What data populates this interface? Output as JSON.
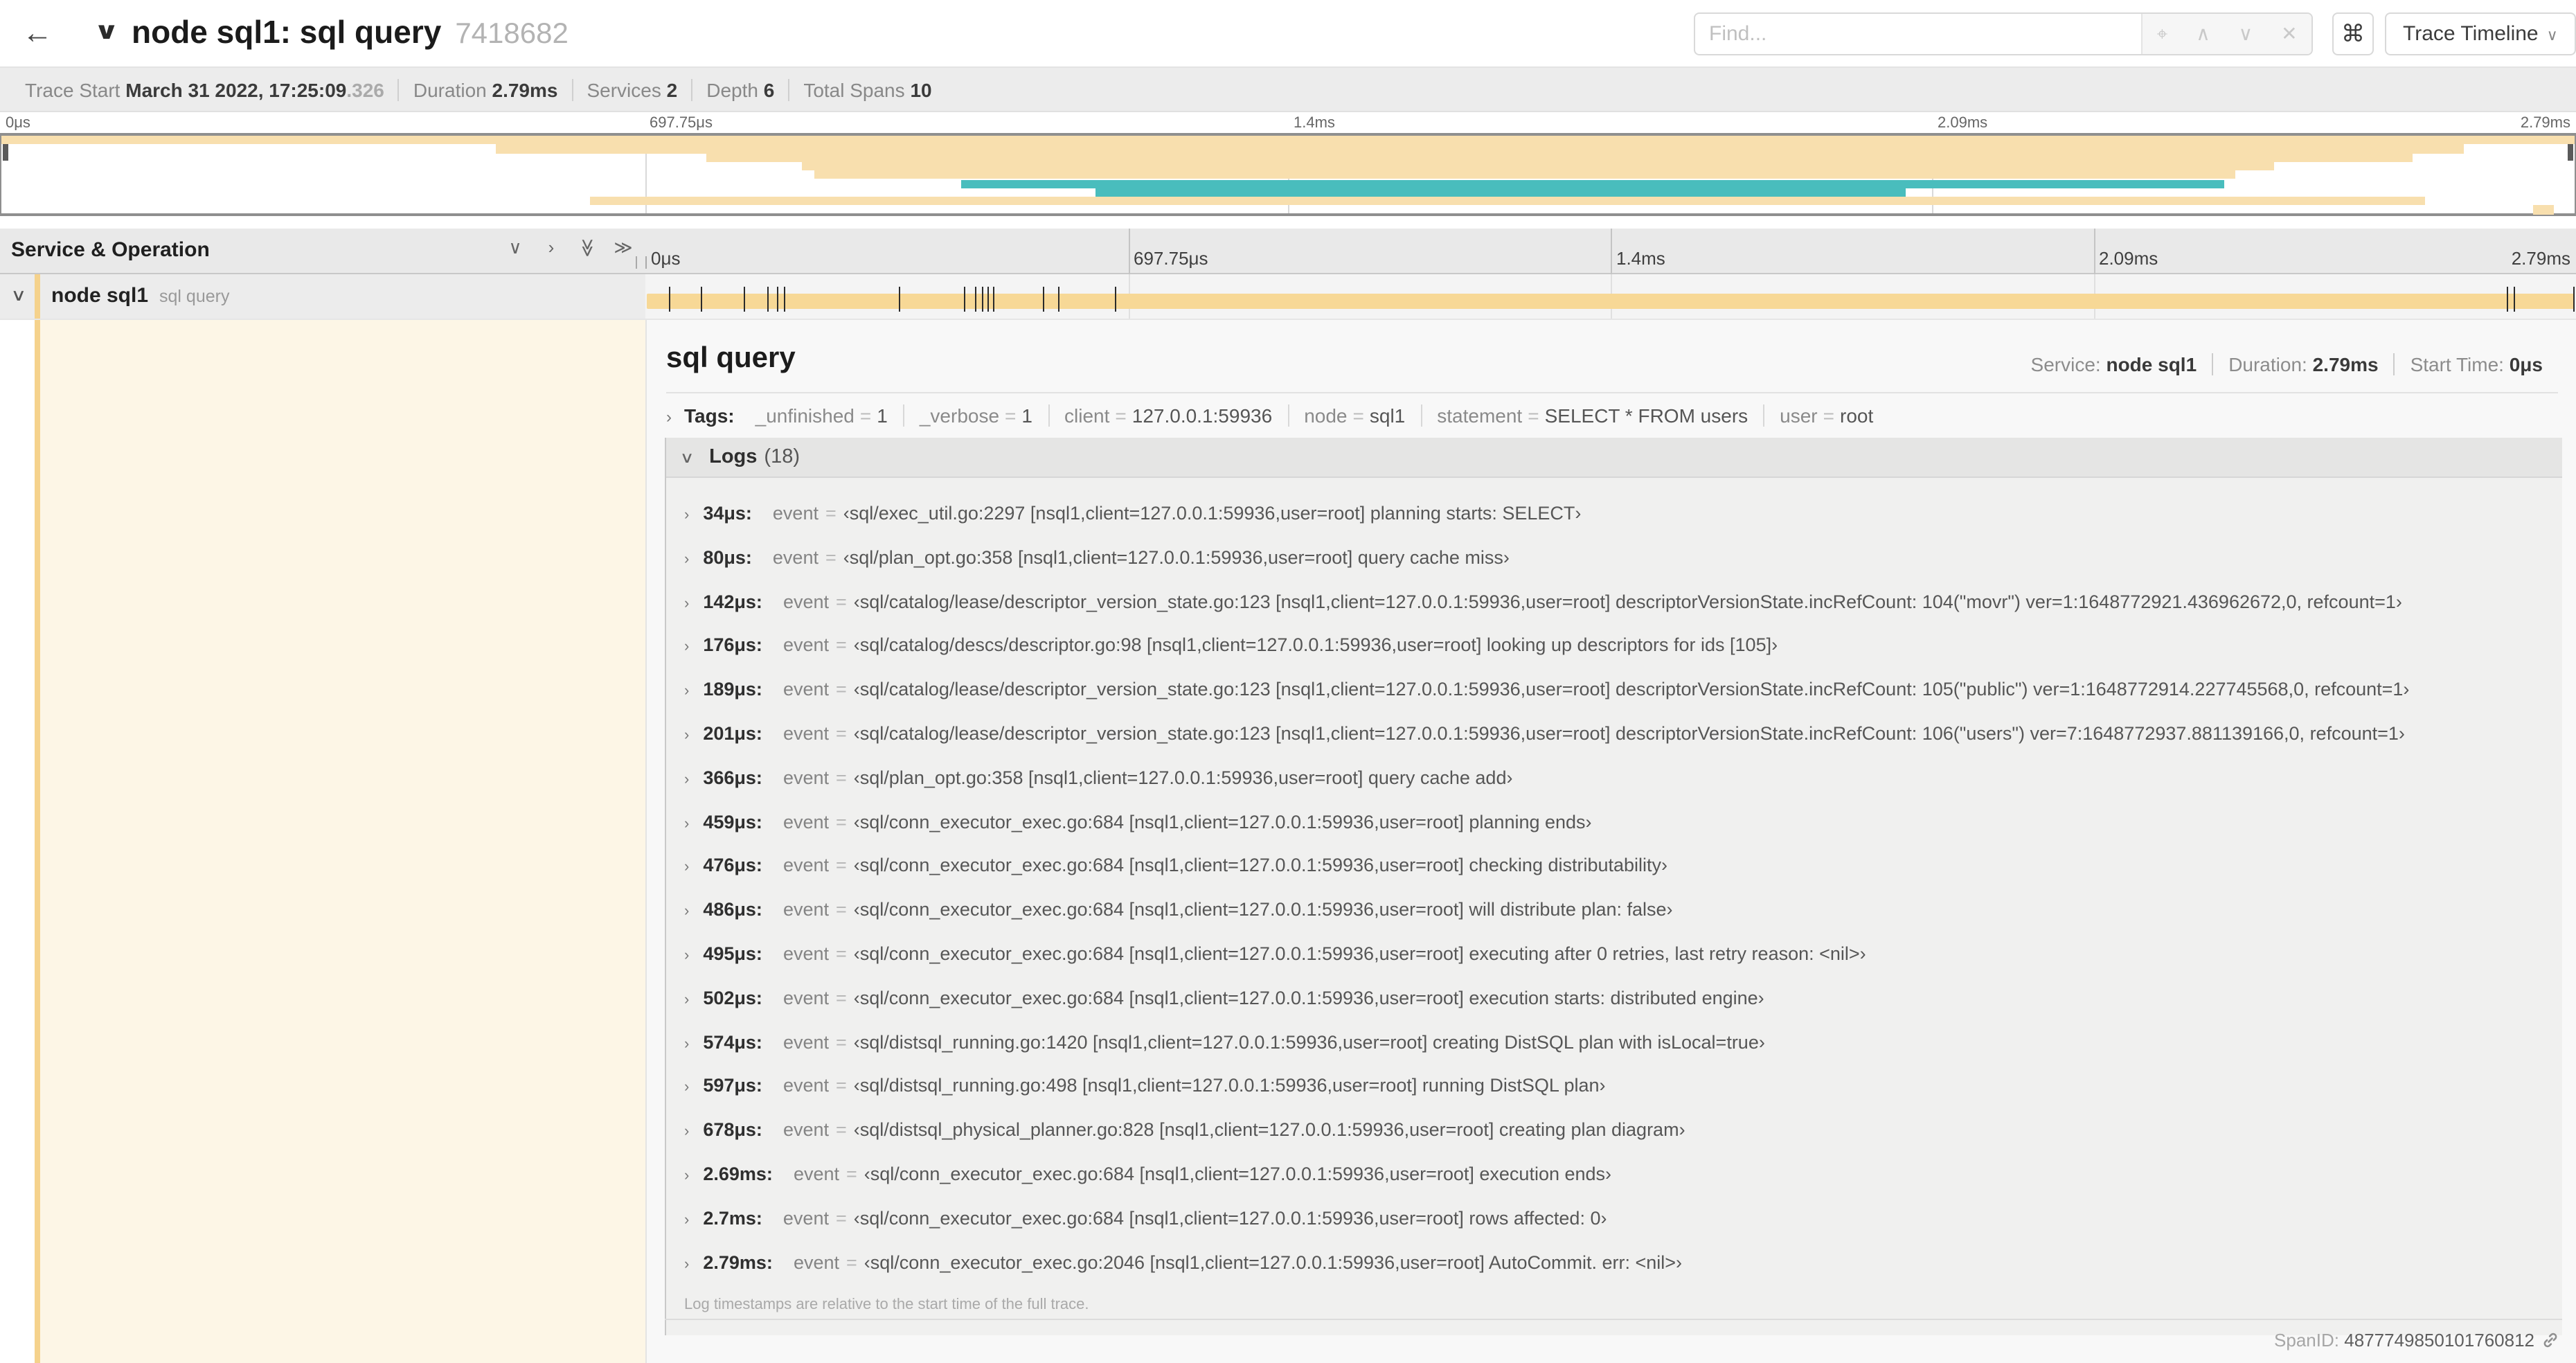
{
  "header": {
    "back_icon": "←",
    "collapse_icon": "∨",
    "title": "node sql1: sql query",
    "trace_id": "7418682",
    "find_placeholder": "Find...",
    "find_icons": [
      {
        "name": "locate-icon",
        "glyph": "⌖"
      },
      {
        "name": "prev-match-icon",
        "glyph": "∧"
      },
      {
        "name": "next-match-icon",
        "glyph": "∨"
      },
      {
        "name": "clear-icon",
        "glyph": "✕"
      }
    ],
    "shortcut_icon": "⌘",
    "view_selector": {
      "label": "Trace Timeline",
      "chevron": "∨"
    }
  },
  "summary": {
    "items": [
      {
        "label": "Trace Start",
        "value": "March 31 2022, 17:25:09",
        "suffix": ".326"
      },
      {
        "label": "Duration",
        "value": "2.79ms"
      },
      {
        "label": "Services",
        "value": "2"
      },
      {
        "label": "Depth",
        "value": "6"
      },
      {
        "label": "Total Spans",
        "value": "10"
      }
    ]
  },
  "colors": {
    "tan": "#f8dfae",
    "teal": "#49bdbd",
    "bar_tan": "#f7d896",
    "stripe_tan": "#f5d28c"
  },
  "minimap": {
    "ticks": [
      "0μs",
      "697.75μs",
      "1.4ms",
      "2.09ms",
      "2.79ms"
    ],
    "spans": [
      {
        "left": 0,
        "width": 100,
        "color": "#f8dfae"
      },
      {
        "left": 19.2,
        "width": 76.5,
        "color": "#f8dfae"
      },
      {
        "left": 27.4,
        "width": 66.3,
        "color": "#f8dfae"
      },
      {
        "left": 31.1,
        "width": 57.2,
        "color": "#f8dfae"
      },
      {
        "left": 31.6,
        "width": 55.2,
        "color": "#f8dfae"
      },
      {
        "left": 37.3,
        "width": 49.1,
        "color": "#49bdbd"
      },
      {
        "left": 42.5,
        "width": 31.5,
        "color": "#49bdbd"
      },
      {
        "left": 22.9,
        "width": 71.3,
        "color": "#f8dfae"
      },
      {
        "left": 98.4,
        "width": 0.8,
        "color": "#f8dfae"
      }
    ]
  },
  "timeline_header": {
    "left_title": "Service & Operation",
    "icons": [
      {
        "name": "collapse-one-icon",
        "glyph": "∨",
        "rotate": false
      },
      {
        "name": "expand-one-icon",
        "glyph": "›",
        "rotate": false
      },
      {
        "name": "collapse-all-icon",
        "glyph": "≫",
        "rotate": true
      },
      {
        "name": "expand-all-icon",
        "glyph": "≫",
        "rotate": false
      }
    ],
    "ticks": [
      "0μs",
      "697.75μs",
      "1.4ms",
      "2.09ms",
      "2.79ms"
    ]
  },
  "span_row": {
    "chevron": "∨",
    "service": "node sql1",
    "operation": "sql query",
    "bar": {
      "left": 0.05,
      "width": 99.9
    },
    "marker_pcts": [
      1.2,
      2.9,
      5.1,
      6.3,
      6.8,
      7.2,
      13.1,
      16.5,
      17.1,
      17.4,
      17.7,
      18.0,
      20.6,
      21.4,
      24.3,
      96.4,
      96.8,
      99.85
    ]
  },
  "detail": {
    "title": "sql query",
    "meta": [
      {
        "label": "Service:",
        "value": "node sql1"
      },
      {
        "label": "Duration:",
        "value": "2.79ms"
      },
      {
        "label": "Start Time:",
        "value": "0μs"
      }
    ],
    "tags": {
      "chevron": "›",
      "label": "Tags:",
      "items": [
        {
          "key": "_unfinished",
          "value": "1"
        },
        {
          "key": "_verbose",
          "value": "1"
        },
        {
          "key": "client",
          "value": "127.0.0.1:59936"
        },
        {
          "key": "node",
          "value": "sql1"
        },
        {
          "key": "statement",
          "value": "SELECT * FROM users"
        },
        {
          "key": "user",
          "value": "root"
        }
      ]
    },
    "logs": {
      "chevron": "∨",
      "label": "Logs",
      "count": "(18)",
      "rows": [
        {
          "t": "34μs:",
          "key": "event",
          "value": "‹sql/exec_util.go:2297 [nsql1,client=127.0.0.1:59936,user=root] planning starts: SELECT›"
        },
        {
          "t": "80μs:",
          "key": "event",
          "value": "‹sql/plan_opt.go:358 [nsql1,client=127.0.0.1:59936,user=root] query cache miss›"
        },
        {
          "t": "142μs:",
          "key": "event",
          "value": "‹sql/catalog/lease/descriptor_version_state.go:123 [nsql1,client=127.0.0.1:59936,user=root] descriptorVersionState.incRefCount: 104(\"movr\") ver=1:1648772921.436962672,0, refcount=1›"
        },
        {
          "t": "176μs:",
          "key": "event",
          "value": "‹sql/catalog/descs/descriptor.go:98 [nsql1,client=127.0.0.1:59936,user=root] looking up descriptors for ids [105]›"
        },
        {
          "t": "189μs:",
          "key": "event",
          "value": "‹sql/catalog/lease/descriptor_version_state.go:123 [nsql1,client=127.0.0.1:59936,user=root] descriptorVersionState.incRefCount: 105(\"public\") ver=1:1648772914.227745568,0, refcount=1›"
        },
        {
          "t": "201μs:",
          "key": "event",
          "value": "‹sql/catalog/lease/descriptor_version_state.go:123 [nsql1,client=127.0.0.1:59936,user=root] descriptorVersionState.incRefCount: 106(\"users\") ver=7:1648772937.881139166,0, refcount=1›"
        },
        {
          "t": "366μs:",
          "key": "event",
          "value": "‹sql/plan_opt.go:358 [nsql1,client=127.0.0.1:59936,user=root] query cache add›"
        },
        {
          "t": "459μs:",
          "key": "event",
          "value": "‹sql/conn_executor_exec.go:684 [nsql1,client=127.0.0.1:59936,user=root] planning ends›"
        },
        {
          "t": "476μs:",
          "key": "event",
          "value": "‹sql/conn_executor_exec.go:684 [nsql1,client=127.0.0.1:59936,user=root] checking distributability›"
        },
        {
          "t": "486μs:",
          "key": "event",
          "value": "‹sql/conn_executor_exec.go:684 [nsql1,client=127.0.0.1:59936,user=root] will distribute plan: false›"
        },
        {
          "t": "495μs:",
          "key": "event",
          "value": "‹sql/conn_executor_exec.go:684 [nsql1,client=127.0.0.1:59936,user=root] executing after 0 retries, last retry reason: <nil>›"
        },
        {
          "t": "502μs:",
          "key": "event",
          "value": "‹sql/conn_executor_exec.go:684 [nsql1,client=127.0.0.1:59936,user=root] execution starts: distributed engine›"
        },
        {
          "t": "574μs:",
          "key": "event",
          "value": "‹sql/distsql_running.go:1420 [nsql1,client=127.0.0.1:59936,user=root] creating DistSQL plan with isLocal=true›"
        },
        {
          "t": "597μs:",
          "key": "event",
          "value": "‹sql/distsql_running.go:498 [nsql1,client=127.0.0.1:59936,user=root] running DistSQL plan›"
        },
        {
          "t": "678μs:",
          "key": "event",
          "value": "‹sql/distsql_physical_planner.go:828 [nsql1,client=127.0.0.1:59936,user=root] creating plan diagram›"
        },
        {
          "t": "2.69ms:",
          "key": "event",
          "value": "‹sql/conn_executor_exec.go:684 [nsql1,client=127.0.0.1:59936,user=root] execution ends›"
        },
        {
          "t": "2.7ms:",
          "key": "event",
          "value": "‹sql/conn_executor_exec.go:684 [nsql1,client=127.0.0.1:59936,user=root] rows affected: 0›"
        },
        {
          "t": "2.79ms:",
          "key": "event",
          "value": "‹sql/conn_executor_exec.go:2046 [nsql1,client=127.0.0.1:59936,user=root] AutoCommit. err: <nil>›"
        }
      ],
      "footer": "Log timestamps are relative to the start time of the full trace."
    },
    "span_id": {
      "label": "SpanID:",
      "value": "4877749850101760812"
    }
  }
}
